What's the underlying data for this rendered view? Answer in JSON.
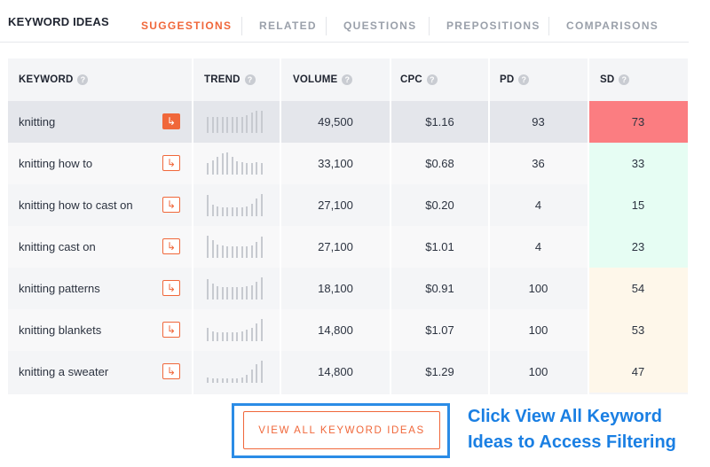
{
  "header": {
    "title": "KEYWORD IDEAS",
    "tabs": [
      "SUGGESTIONS",
      "RELATED",
      "QUESTIONS",
      "PREPOSITIONS",
      "COMPARISONS"
    ],
    "active_tab": "SUGGESTIONS"
  },
  "table": {
    "columns": [
      "KEYWORD",
      "TREND",
      "VOLUME",
      "CPC",
      "PD",
      "SD"
    ],
    "rows": [
      {
        "keyword": "knitting",
        "volume": "49,500",
        "cpc": "$1.16",
        "pd": "93",
        "sd": "73",
        "sd_color": "#fb7d81",
        "trend": [
          0.7,
          0.7,
          0.7,
          0.7,
          0.7,
          0.7,
          0.7,
          0.7,
          0.8,
          0.9,
          1.0,
          1.0
        ]
      },
      {
        "keyword": "knitting how to",
        "volume": "33,100",
        "cpc": "$0.68",
        "pd": "36",
        "sd": "33",
        "sd_color": "#e6fdf3",
        "trend": [
          0.5,
          0.65,
          0.8,
          0.95,
          1.0,
          0.8,
          0.6,
          0.55,
          0.5,
          0.5,
          0.55,
          0.5
        ]
      },
      {
        "keyword": "knitting how to cast on",
        "volume": "27,100",
        "cpc": "$0.20",
        "pd": "4",
        "sd": "15",
        "sd_color": "#e6fdf3",
        "trend": [
          0.95,
          0.5,
          0.45,
          0.4,
          0.4,
          0.4,
          0.4,
          0.4,
          0.45,
          0.55,
          0.8,
          1.0
        ]
      },
      {
        "keyword": "knitting cast on",
        "volume": "27,100",
        "cpc": "$1.01",
        "pd": "4",
        "sd": "23",
        "sd_color": "#e6fdf3",
        "trend": [
          1.0,
          0.8,
          0.6,
          0.55,
          0.5,
          0.5,
          0.5,
          0.5,
          0.5,
          0.55,
          0.7,
          0.95
        ]
      },
      {
        "keyword": "knitting patterns",
        "volume": "18,100",
        "cpc": "$0.91",
        "pd": "100",
        "sd": "54",
        "sd_color": "#fef7ea",
        "trend": [
          0.9,
          0.7,
          0.6,
          0.55,
          0.55,
          0.55,
          0.55,
          0.55,
          0.6,
          0.65,
          0.8,
          1.0
        ]
      },
      {
        "keyword": "knitting blankets",
        "volume": "14,800",
        "cpc": "$1.07",
        "pd": "100",
        "sd": "53",
        "sd_color": "#fef7ea",
        "trend": [
          0.6,
          0.45,
          0.4,
          0.4,
          0.4,
          0.4,
          0.4,
          0.45,
          0.5,
          0.6,
          0.8,
          1.0
        ]
      },
      {
        "keyword": "knitting a sweater",
        "volume": "14,800",
        "cpc": "$1.29",
        "pd": "100",
        "sd": "47",
        "sd_color": "#fef7ea",
        "trend": [
          0.25,
          0.2,
          0.2,
          0.2,
          0.2,
          0.2,
          0.2,
          0.25,
          0.35,
          0.6,
          0.85,
          1.0
        ]
      }
    ]
  },
  "cta": {
    "label": "VIEW ALL KEYWORD IDEAS"
  },
  "callout": {
    "line1": "Click View All Keyword",
    "line2": "Ideas to Access Filtering"
  },
  "icons": {
    "help": "question-circle-icon",
    "open": "arrow-return-icon"
  },
  "colors": {
    "accent": "#f0673a",
    "callout": "#1a7fe3",
    "callout_border": "#2b8ce6"
  }
}
